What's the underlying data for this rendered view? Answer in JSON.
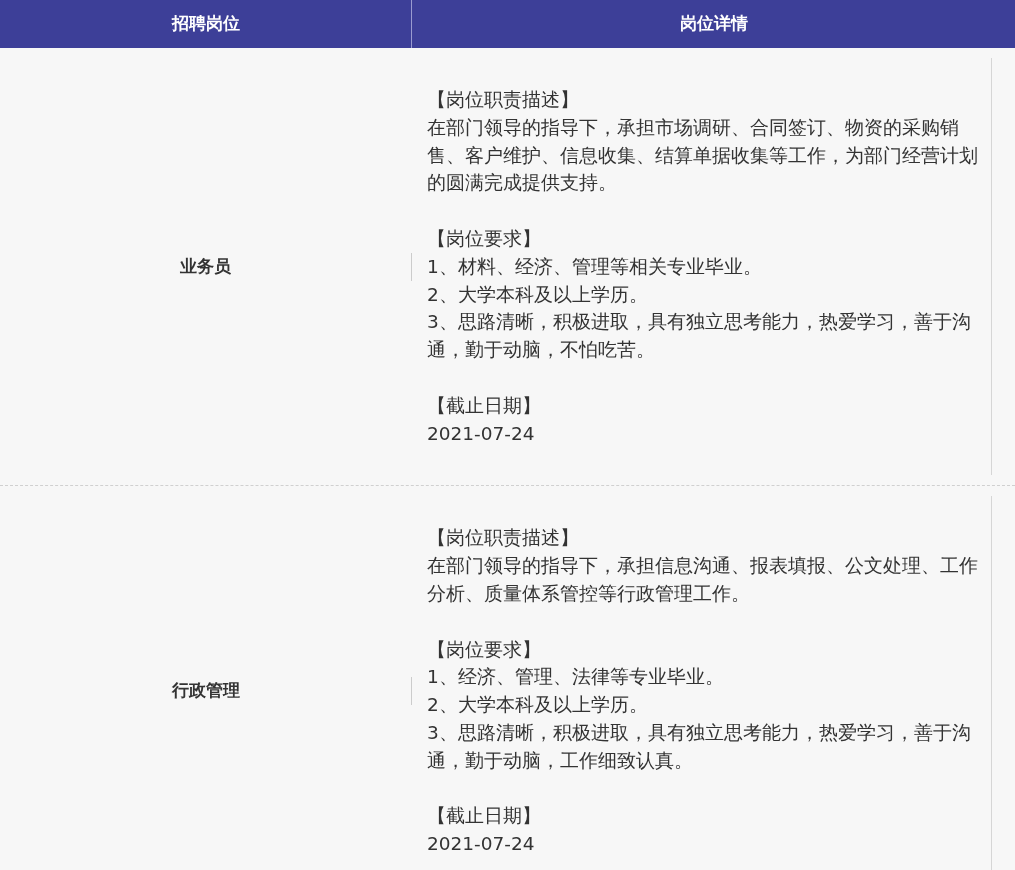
{
  "columns": [
    "招聘岗位",
    "岗位详情"
  ],
  "rows": [
    {
      "position": "业务员",
      "sections": [
        {
          "heading": "【岗位职责描述】",
          "lines": [
            "在部门领导的指导下，承担市场调研、合同签订、物资的采购销售、客户维护、信息收集、结算单据收集等工作，为部门经营计划的圆满完成提供支持。"
          ]
        },
        {
          "heading": "【岗位要求】",
          "lines": [
            "1、材料、经济、管理等相关专业毕业。",
            "2、大学本科及以上学历。",
            "3、思路清晰，积极进取，具有独立思考能力，热爱学习，善于沟通，勤于动脑，不怕吃苦。"
          ]
        },
        {
          "heading": "【截止日期】",
          "lines": [
            "2021-07-24"
          ]
        }
      ]
    },
    {
      "position": "行政管理",
      "sections": [
        {
          "heading": "【岗位职责描述】",
          "lines": [
            "在部门领导的指导下，承担信息沟通、报表填报、公文处理、工作分析、质量体系管控等行政管理工作。"
          ]
        },
        {
          "heading": "【岗位要求】",
          "lines": [
            "1、经济、管理、法律等专业毕业。",
            "2、大学本科及以上学历。",
            "3、思路清晰，积极进取，具有独立思考能力，热爱学习，善于沟通，勤于动脑，工作细致认真。"
          ]
        },
        {
          "heading": "【截止日期】",
          "lines": [
            "2021-07-24"
          ]
        }
      ]
    }
  ]
}
